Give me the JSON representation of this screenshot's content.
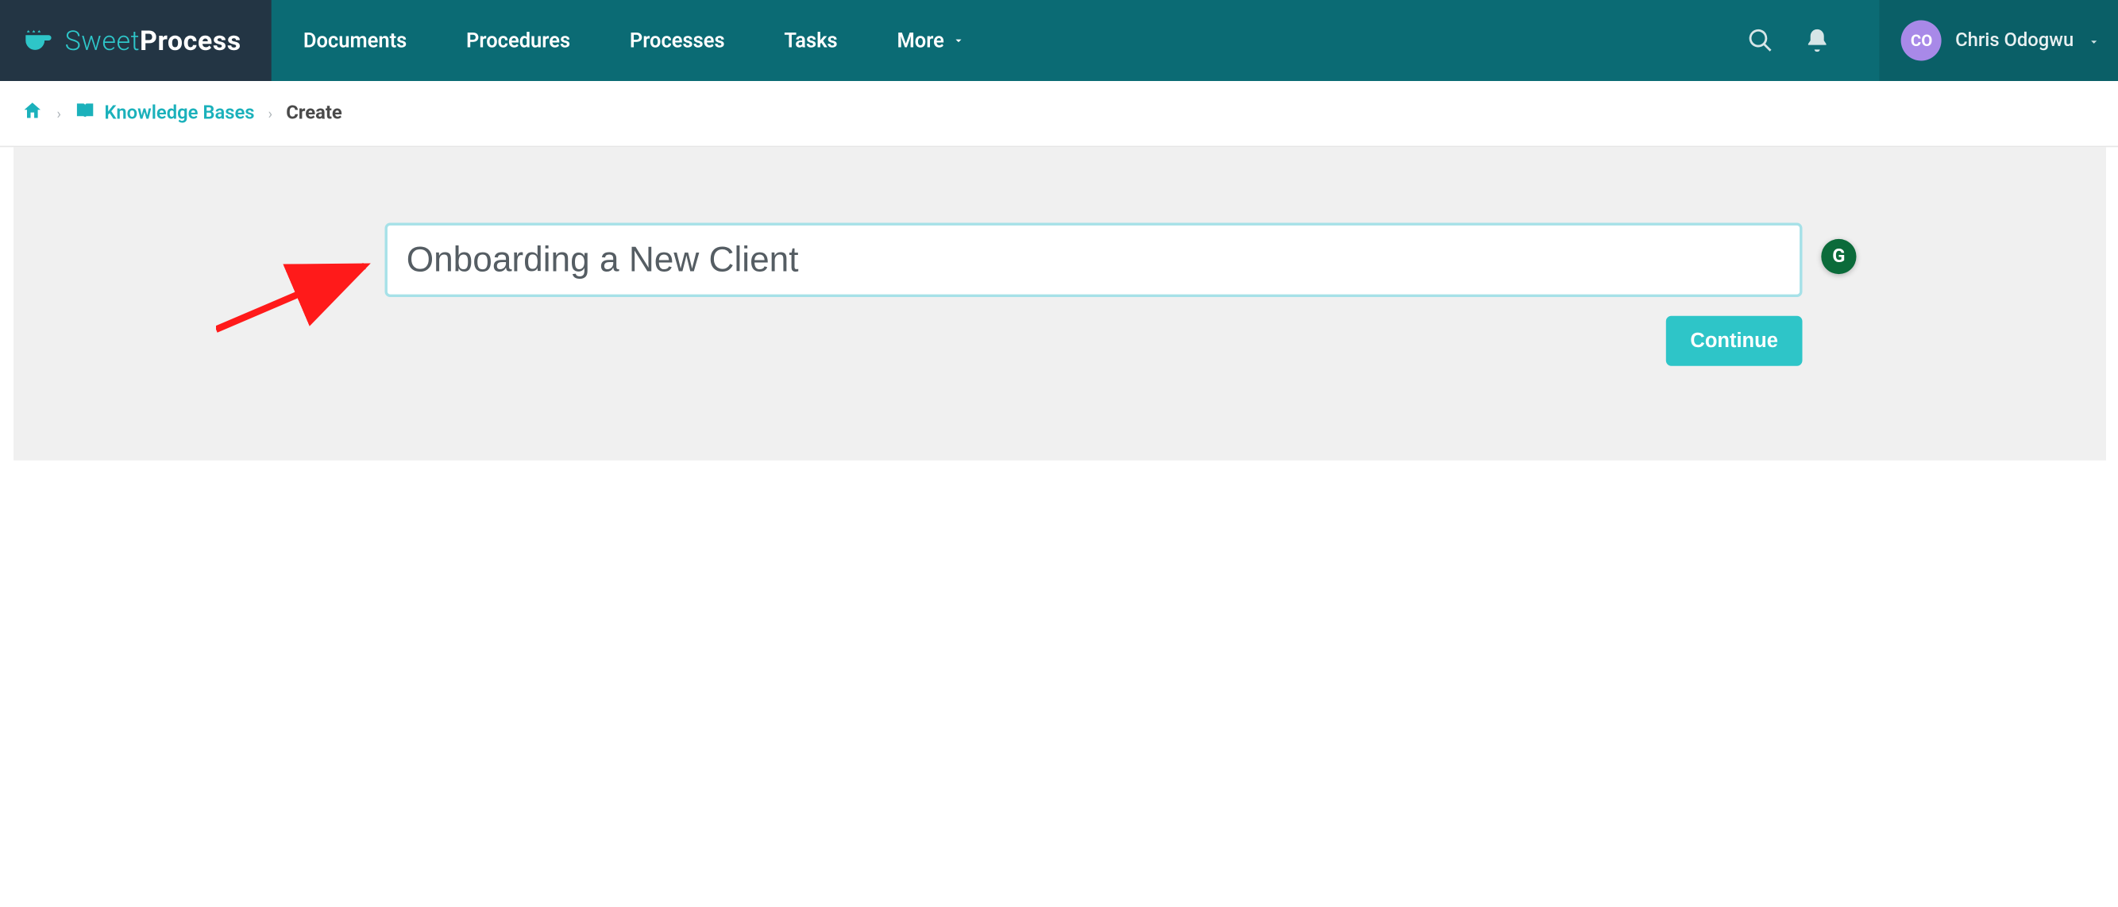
{
  "brand": {
    "left": "Sweet",
    "right": "Process"
  },
  "nav": {
    "items": [
      {
        "label": "Documents"
      },
      {
        "label": "Procedures"
      },
      {
        "label": "Processes"
      },
      {
        "label": "Tasks"
      },
      {
        "label": "More"
      }
    ]
  },
  "user": {
    "initials": "CO",
    "name": "Chris Odogwu"
  },
  "breadcrumb": {
    "kb": "Knowledge Bases",
    "current": "Create"
  },
  "form": {
    "title_value": "Onboarding a New Client",
    "continue_label": "Continue"
  },
  "icons": {
    "grammarly_letter": "G"
  }
}
